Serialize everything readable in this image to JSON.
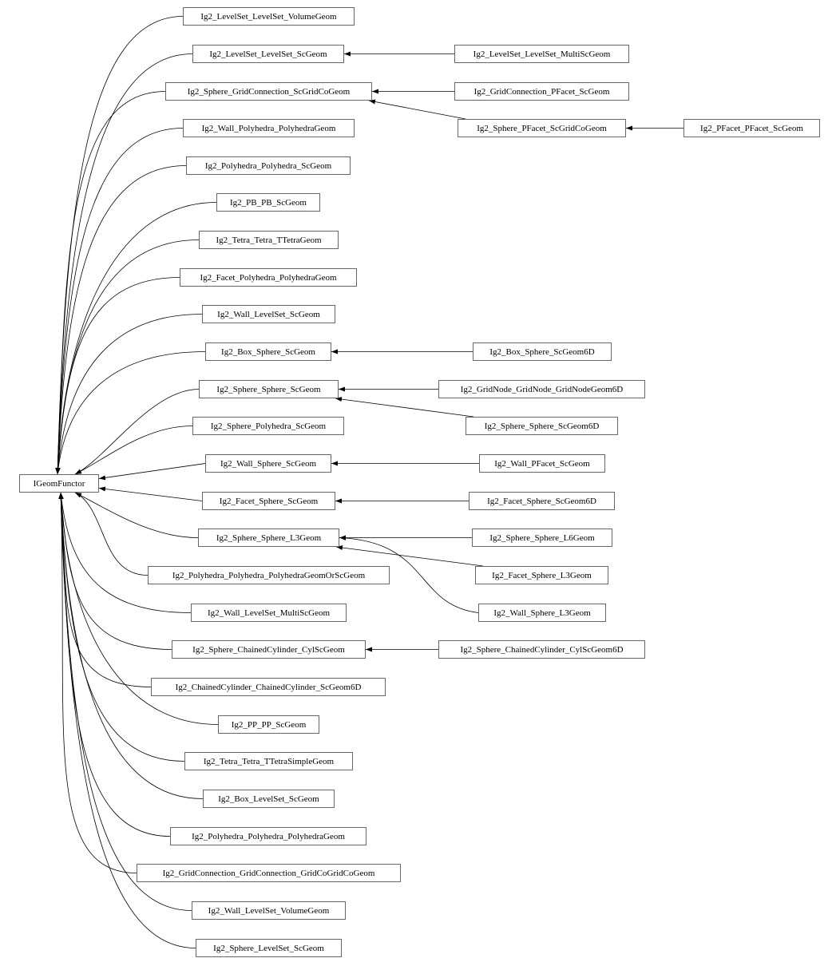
{
  "diagram": {
    "type": "class-inheritance-graph",
    "root": "IGeomFunctor",
    "nodes": [
      {
        "id": "IGeomFunctor",
        "label": "IGeomFunctor"
      },
      {
        "id": "n1",
        "label": "Ig2_LevelSet_LevelSet_VolumeGeom"
      },
      {
        "id": "n2",
        "label": "Ig2_LevelSet_LevelSet_ScGeom"
      },
      {
        "id": "n3",
        "label": "Ig2_Sphere_GridConnection_ScGridCoGeom"
      },
      {
        "id": "n4",
        "label": "Ig2_Wall_Polyhedra_PolyhedraGeom"
      },
      {
        "id": "n5",
        "label": "Ig2_Polyhedra_Polyhedra_ScGeom"
      },
      {
        "id": "n6",
        "label": "Ig2_PB_PB_ScGeom"
      },
      {
        "id": "n7",
        "label": "Ig2_Tetra_Tetra_TTetraGeom"
      },
      {
        "id": "n8",
        "label": "Ig2_Facet_Polyhedra_PolyhedraGeom"
      },
      {
        "id": "n9",
        "label": "Ig2_Wall_LevelSet_ScGeom"
      },
      {
        "id": "n10",
        "label": "Ig2_Box_Sphere_ScGeom"
      },
      {
        "id": "n11",
        "label": "Ig2_Sphere_Sphere_ScGeom"
      },
      {
        "id": "n12",
        "label": "Ig2_Sphere_Polyhedra_ScGeom"
      },
      {
        "id": "n13",
        "label": "Ig2_Wall_Sphere_ScGeom"
      },
      {
        "id": "n14",
        "label": "Ig2_Facet_Sphere_ScGeom"
      },
      {
        "id": "n15",
        "label": "Ig2_Sphere_Sphere_L3Geom"
      },
      {
        "id": "n16",
        "label": "Ig2_Polyhedra_Polyhedra_PolyhedraGeomOrScGeom"
      },
      {
        "id": "n17",
        "label": "Ig2_Wall_LevelSet_MultiScGeom"
      },
      {
        "id": "n18",
        "label": "Ig2_Sphere_ChainedCylinder_CylScGeom"
      },
      {
        "id": "n19",
        "label": "Ig2_ChainedCylinder_ChainedCylinder_ScGeom6D"
      },
      {
        "id": "n20",
        "label": "Ig2_PP_PP_ScGeom"
      },
      {
        "id": "n21",
        "label": "Ig2_Tetra_Tetra_TTetraSimpleGeom"
      },
      {
        "id": "n22",
        "label": "Ig2_Box_LevelSet_ScGeom"
      },
      {
        "id": "n23",
        "label": "Ig2_Polyhedra_Polyhedra_PolyhedraGeom"
      },
      {
        "id": "n24",
        "label": "Ig2_GridConnection_GridConnection_GridCoGridCoGeom"
      },
      {
        "id": "n25",
        "label": "Ig2_Wall_LevelSet_VolumeGeom"
      },
      {
        "id": "n26",
        "label": "Ig2_Sphere_LevelSet_ScGeom"
      },
      {
        "id": "c1",
        "label": "Ig2_LevelSet_LevelSet_MultiScGeom"
      },
      {
        "id": "c2",
        "label": "Ig2_GridConnection_PFacet_ScGeom"
      },
      {
        "id": "c3",
        "label": "Ig2_Sphere_PFacet_ScGridCoGeom"
      },
      {
        "id": "c4",
        "label": "Ig2_PFacet_PFacet_ScGeom"
      },
      {
        "id": "c5",
        "label": "Ig2_Box_Sphere_ScGeom6D"
      },
      {
        "id": "c6",
        "label": "Ig2_GridNode_GridNode_GridNodeGeom6D"
      },
      {
        "id": "c7",
        "label": "Ig2_Sphere_Sphere_ScGeom6D"
      },
      {
        "id": "c8",
        "label": "Ig2_Wall_PFacet_ScGeom"
      },
      {
        "id": "c9",
        "label": "Ig2_Facet_Sphere_ScGeom6D"
      },
      {
        "id": "c10",
        "label": "Ig2_Sphere_Sphere_L6Geom"
      },
      {
        "id": "c11",
        "label": "Ig2_Facet_Sphere_L3Geom"
      },
      {
        "id": "c12",
        "label": "Ig2_Wall_Sphere_L3Geom"
      },
      {
        "id": "c13",
        "label": "Ig2_Sphere_ChainedCylinder_CylScGeom6D"
      }
    ],
    "edges": [
      {
        "from": "n1",
        "to": "IGeomFunctor"
      },
      {
        "from": "n2",
        "to": "IGeomFunctor"
      },
      {
        "from": "n3",
        "to": "IGeomFunctor"
      },
      {
        "from": "n4",
        "to": "IGeomFunctor"
      },
      {
        "from": "n5",
        "to": "IGeomFunctor"
      },
      {
        "from": "n6",
        "to": "IGeomFunctor"
      },
      {
        "from": "n7",
        "to": "IGeomFunctor"
      },
      {
        "from": "n8",
        "to": "IGeomFunctor"
      },
      {
        "from": "n9",
        "to": "IGeomFunctor"
      },
      {
        "from": "n10",
        "to": "IGeomFunctor"
      },
      {
        "from": "n11",
        "to": "IGeomFunctor"
      },
      {
        "from": "n12",
        "to": "IGeomFunctor"
      },
      {
        "from": "n13",
        "to": "IGeomFunctor"
      },
      {
        "from": "n14",
        "to": "IGeomFunctor"
      },
      {
        "from": "n15",
        "to": "IGeomFunctor"
      },
      {
        "from": "n16",
        "to": "IGeomFunctor"
      },
      {
        "from": "n17",
        "to": "IGeomFunctor"
      },
      {
        "from": "n18",
        "to": "IGeomFunctor"
      },
      {
        "from": "n19",
        "to": "IGeomFunctor"
      },
      {
        "from": "n20",
        "to": "IGeomFunctor"
      },
      {
        "from": "n21",
        "to": "IGeomFunctor"
      },
      {
        "from": "n22",
        "to": "IGeomFunctor"
      },
      {
        "from": "n23",
        "to": "IGeomFunctor"
      },
      {
        "from": "n24",
        "to": "IGeomFunctor"
      },
      {
        "from": "n25",
        "to": "IGeomFunctor"
      },
      {
        "from": "n26",
        "to": "IGeomFunctor"
      },
      {
        "from": "c1",
        "to": "n2"
      },
      {
        "from": "c2",
        "to": "n3"
      },
      {
        "from": "c3",
        "to": "n3"
      },
      {
        "from": "c4",
        "to": "c3"
      },
      {
        "from": "c5",
        "to": "n10"
      },
      {
        "from": "c6",
        "to": "n11"
      },
      {
        "from": "c7",
        "to": "n11"
      },
      {
        "from": "c8",
        "to": "n13"
      },
      {
        "from": "c9",
        "to": "n14"
      },
      {
        "from": "c10",
        "to": "n15"
      },
      {
        "from": "c11",
        "to": "n15"
      },
      {
        "from": "c12",
        "to": "n15"
      },
      {
        "from": "c13",
        "to": "n18"
      }
    ]
  }
}
